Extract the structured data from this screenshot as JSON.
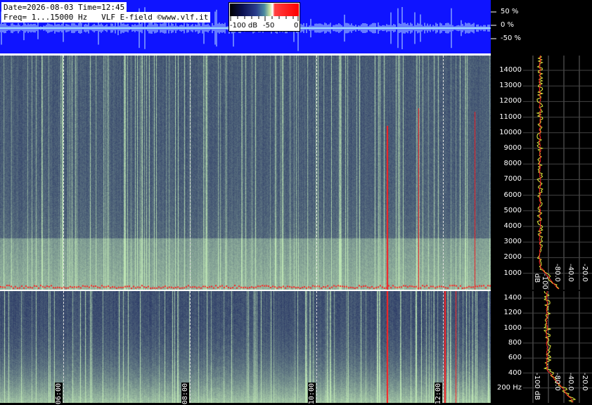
{
  "header": {
    "date_line": "Date=2026-08-03 Time=12:45",
    "freq_line": "Freq= 1...15000 Hz   VLF E-field ©www.vlf.it"
  },
  "colorbar": {
    "ticks": [
      "-100 dB",
      "-50",
      "0"
    ]
  },
  "amplitude_scale": [
    "50 %",
    "0 %",
    "-50 %"
  ],
  "time_labels": [
    "06:00",
    "08:00",
    "10:00",
    "12:00"
  ],
  "freq_top": [
    "14000",
    "13000",
    "12000",
    "11000",
    "10000",
    "9000",
    "8000",
    "7000",
    "6000",
    "5000",
    "4000",
    "3000",
    "2000",
    "1000"
  ],
  "freq_bottom": [
    "1400",
    "1200",
    "1000",
    "800",
    "600",
    "400",
    "200 Hz"
  ],
  "db_top": [
    "-100 dB",
    "-80.0",
    "-40.0",
    "-20.0"
  ],
  "db_bottom": [
    "-100 dB",
    "-80.0",
    "-40.0",
    "-20.0"
  ],
  "colors": {
    "oscillogram_bg": "#0f14ff",
    "spectrum_low": "#15205a",
    "spectrum_high": "#c7e3a0",
    "accent": "#ff0000"
  }
}
